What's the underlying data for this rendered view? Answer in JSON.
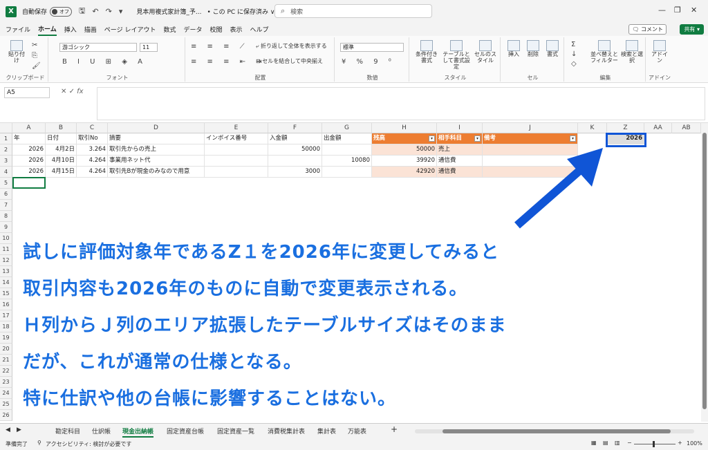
{
  "titlebar": {
    "autosave": "自動保存",
    "autosave_state": "オフ",
    "doc_title": "見本用複式家計簿_予...",
    "saved": "• この PC に保存済み ∨",
    "search_placeholder": "検索"
  },
  "menu": {
    "tabs": [
      "ファイル",
      "ホーム",
      "挿入",
      "描画",
      "ページ レイアウト",
      "数式",
      "データ",
      "校閲",
      "表示",
      "ヘルプ"
    ],
    "comment": "コメント",
    "share": "共有"
  },
  "ribbon": {
    "paste": "貼り付け",
    "clipboard": "クリップボード",
    "font_name": "游ゴシック",
    "font_size": "11",
    "font": "フォント",
    "wrap": "折り返して全体を表示する",
    "merge": "セルを結合して中央揃え",
    "alignment": "配置",
    "number_format": "標準",
    "number": "数値",
    "cond_format": "条件付き書式",
    "table_format": "テーブルとして書式設定",
    "cell_style": "セルのスタイル",
    "styles": "スタイル",
    "insert": "挿入",
    "delete": "削除",
    "format": "書式",
    "cells": "セル",
    "sort_filter": "並べ替えとフィルター",
    "find_select": "検索と選択",
    "editing": "編集",
    "addin": "アドイン",
    "addins": "アドイン"
  },
  "formula_bar": {
    "name_box": "A5",
    "fx": "fx",
    "value": ""
  },
  "grid": {
    "columns": [
      "A",
      "B",
      "C",
      "D",
      "E",
      "F",
      "G",
      "H",
      "I",
      "J",
      "K",
      "Z",
      "AA",
      "AB"
    ],
    "rows": [
      "1",
      "2",
      "3",
      "4",
      "5",
      "6",
      "7",
      "8",
      "9",
      "10",
      "11",
      "12",
      "13",
      "14",
      "15",
      "16",
      "17",
      "18",
      "19",
      "20",
      "21",
      "22",
      "23",
      "24",
      "25",
      "26"
    ],
    "headers": {
      "year": "年",
      "date": "日付",
      "ref": "取引No",
      "summary": "摘要",
      "invoice": "インボイス番号",
      "deposit": "入金額",
      "withdrawal": "出金額",
      "balance": "残高",
      "account": "相手科目",
      "note": "備考"
    },
    "z1": "2026",
    "records": [
      {
        "year": "2026",
        "date": "4月2日",
        "ref": "3.264",
        "summary": "取引先からの売上",
        "deposit": "50000",
        "withdrawal": "",
        "balance": "50000",
        "account": "売上"
      },
      {
        "year": "2026",
        "date": "4月10日",
        "ref": "4.264",
        "summary": "事業用ネット代",
        "deposit": "",
        "withdrawal": "10080",
        "balance": "39920",
        "account": "通信費"
      },
      {
        "year": "2026",
        "date": "4月15日",
        "ref": "4.264",
        "summary": "取引先Bが現金のみなので用意",
        "deposit": "3000",
        "withdrawal": "",
        "balance": "42920",
        "account": "通信費"
      }
    ]
  },
  "annotation": {
    "lines": [
      "試しに評価対象年であるZ１を2026年に変更してみると",
      "取引内容も2026年のものに自動で変更表示される。",
      "Ｈ列からＪ列のエリア拡張したテーブルサイズはそのまま",
      "だが、これが通常の仕様となる。",
      "特に仕訳や他の台帳に影響することはない。"
    ]
  },
  "sheets": {
    "tabs": [
      "勘定科目",
      "仕訳帳",
      "現金出納帳",
      "固定資産台帳",
      "固定資産一覧",
      "消費税集計表",
      "集計表",
      "万能表"
    ],
    "active": "現金出納帳",
    "add": "+"
  },
  "status": {
    "ready": "準備完了",
    "accessibility": "アクセシビリティ: 検討が必要です",
    "zoom": "100%"
  },
  "colors": {
    "excel_green": "#107c41",
    "table_header": "#ed7d31",
    "table_row": "#fbe3d6",
    "annotation": "#1a6fe0",
    "arrow": "#1055d6"
  }
}
